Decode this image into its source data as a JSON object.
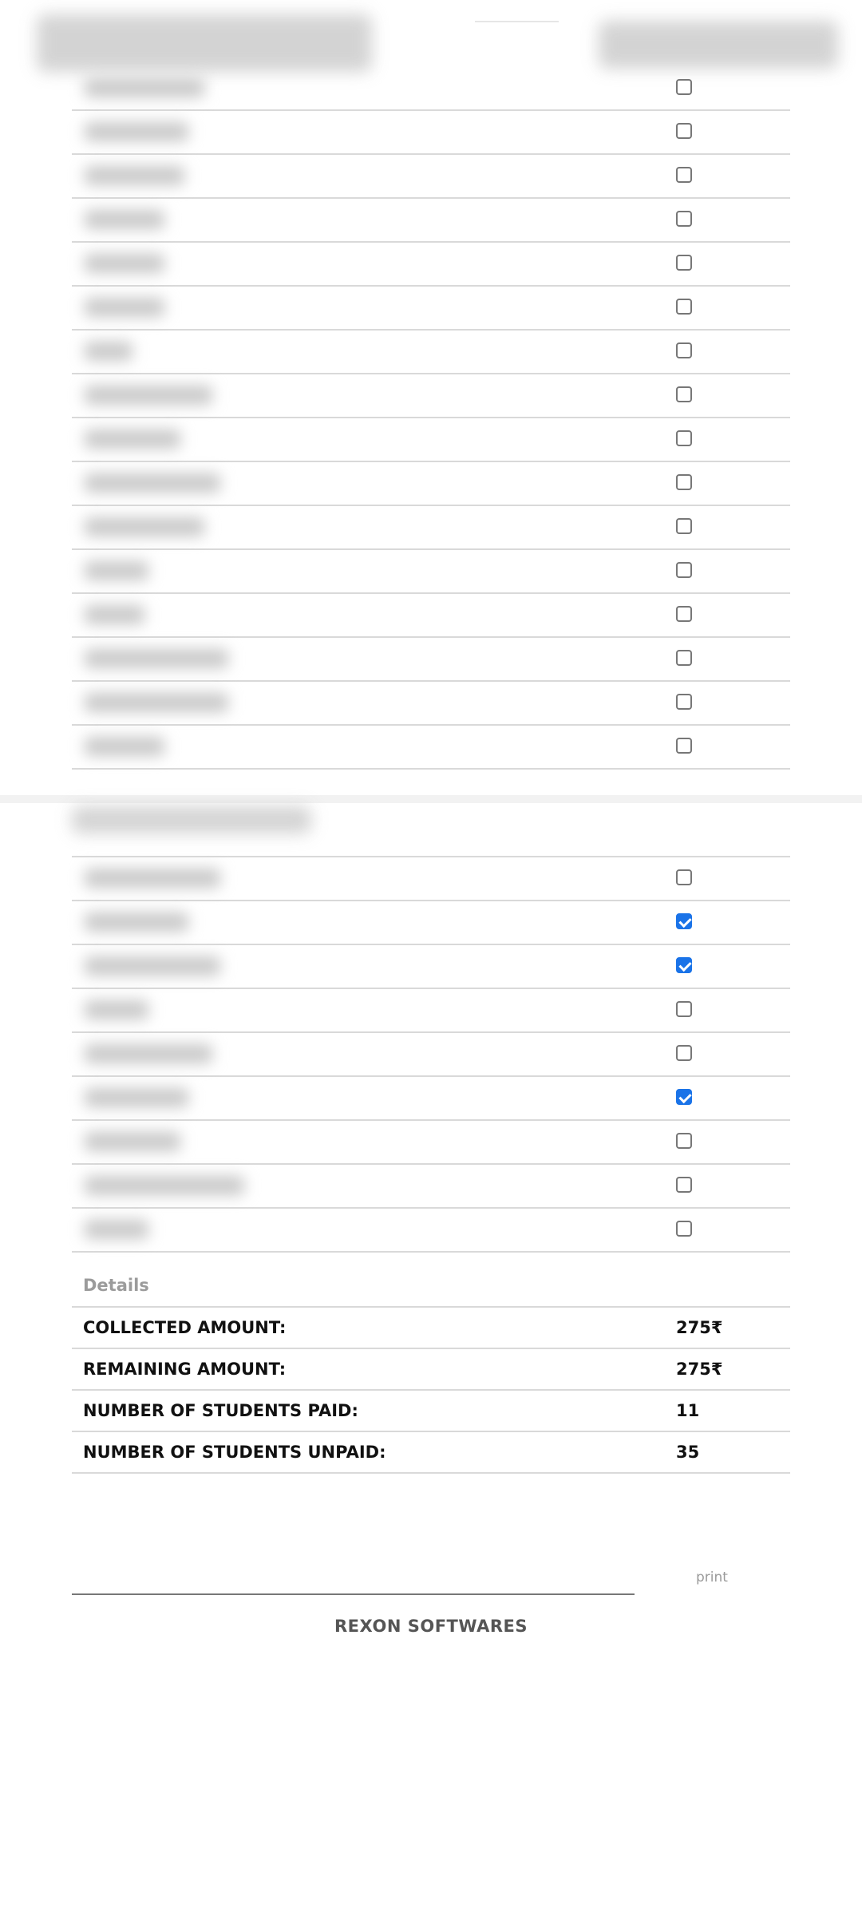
{
  "details": {
    "title": "Details",
    "rows": [
      {
        "label": "COLLECTED AMOUNT:",
        "value": "275₹"
      },
      {
        "label": "REMAINING AMOUNT:",
        "value": "275₹"
      },
      {
        "label": "NUMBER OF STUDENTS PAID:",
        "value": "11"
      },
      {
        "label": "NUMBER OF STUDENTS UNPAID:",
        "value": "35"
      }
    ]
  },
  "print_label": "print",
  "brand": "REXON SOFTWARES",
  "list_a": {
    "items": [
      {
        "checked": false
      },
      {
        "checked": false
      },
      {
        "checked": false
      },
      {
        "checked": false
      },
      {
        "checked": false
      },
      {
        "checked": false
      },
      {
        "checked": false
      },
      {
        "checked": false
      },
      {
        "checked": false
      },
      {
        "checked": false
      },
      {
        "checked": false
      },
      {
        "checked": false
      },
      {
        "checked": false
      },
      {
        "checked": false
      },
      {
        "checked": false
      },
      {
        "checked": false
      }
    ]
  },
  "list_b": {
    "items": [
      {
        "checked": false
      },
      {
        "checked": true
      },
      {
        "checked": true
      },
      {
        "checked": false
      },
      {
        "checked": false
      },
      {
        "checked": true
      },
      {
        "checked": false
      },
      {
        "checked": false
      },
      {
        "checked": false
      }
    ]
  },
  "colors": {
    "checkbox_checked": "#1a73e8",
    "details_title": "#9b9b9b",
    "brand": "#555555"
  }
}
